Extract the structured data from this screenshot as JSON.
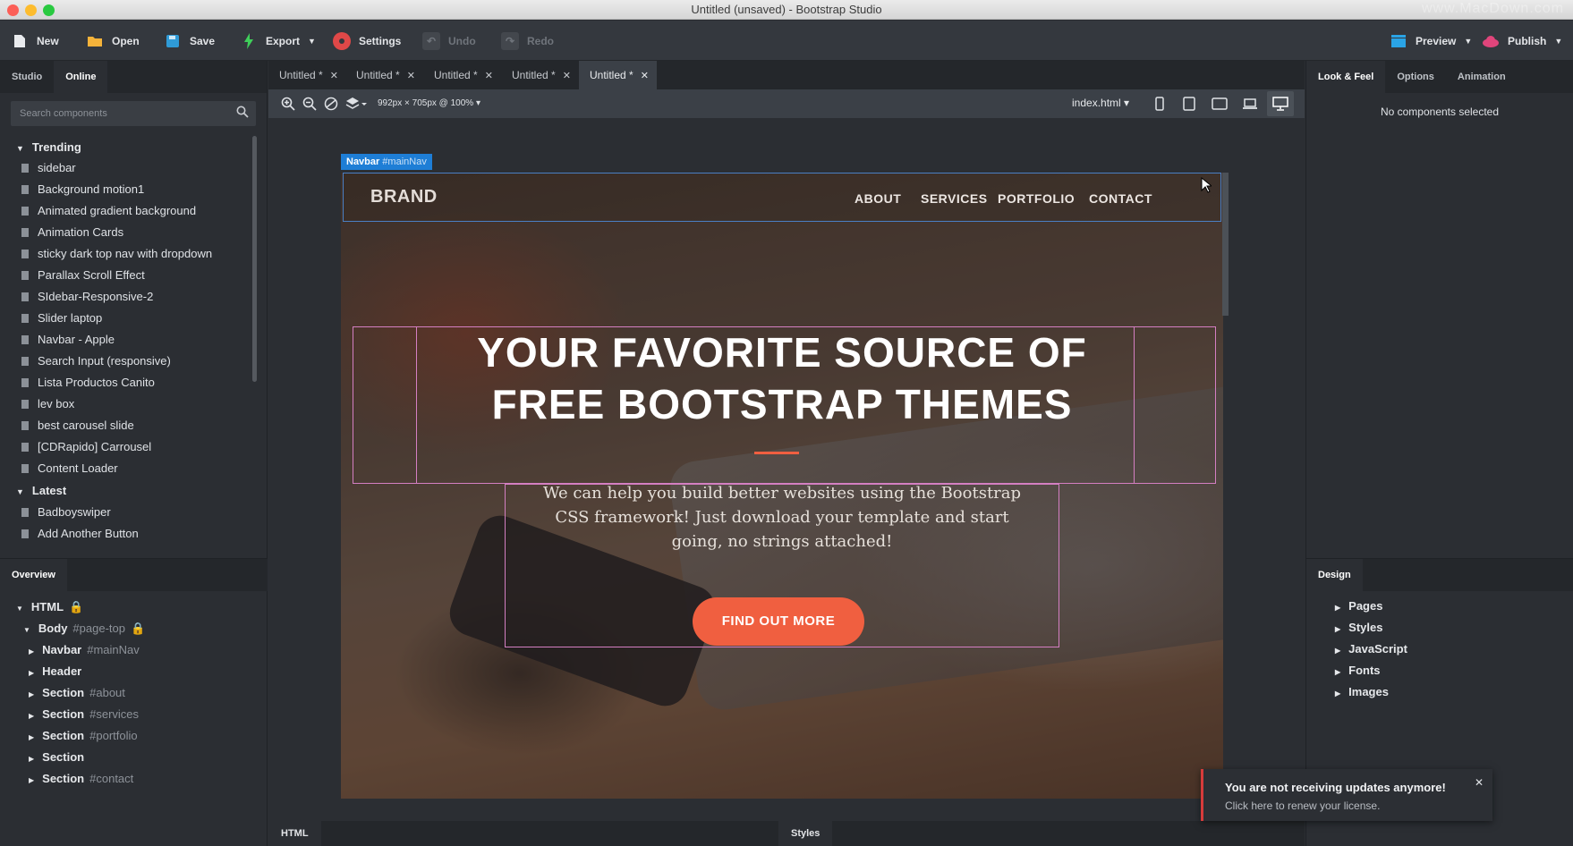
{
  "window": {
    "title": "Untitled (unsaved) - Bootstrap Studio",
    "watermark": "www.MacDown.com"
  },
  "toolbar": {
    "new": "New",
    "open": "Open",
    "save": "Save",
    "export": "Export",
    "settings": "Settings",
    "undo": "Undo",
    "redo": "Redo",
    "preview": "Preview",
    "publish": "Publish"
  },
  "left_panel": {
    "tabs": [
      "Studio",
      "Online"
    ],
    "search_placeholder": "Search components",
    "trending_label": "Trending",
    "trending": [
      "sidebar",
      "Background motion1",
      "Animated gradient background",
      "Animation Cards",
      "sticky dark top nav with dropdown",
      "Parallax Scroll Effect",
      "SIdebar-Responsive-2",
      "Slider laptop",
      "Navbar - Apple",
      "Search Input (responsive)",
      "Lista Productos Canito",
      "lev box",
      "best carousel slide",
      "[CDRapido] Carrousel",
      "Content Loader"
    ],
    "latest_label": "Latest",
    "latest": [
      "Badboyswiper",
      "Add Another Button"
    ]
  },
  "overview": {
    "title": "Overview",
    "html": "HTML",
    "body": "Body",
    "body_id": "#page-top",
    "nodes": [
      {
        "name": "Navbar",
        "id": "#mainNav"
      },
      {
        "name": "Header",
        "id": ""
      },
      {
        "name": "Section",
        "id": "#about"
      },
      {
        "name": "Section",
        "id": "#services"
      },
      {
        "name": "Section",
        "id": "#portfolio"
      },
      {
        "name": "Section",
        "id": ""
      },
      {
        "name": "Section",
        "id": "#contact"
      }
    ]
  },
  "doc_tabs": [
    "Untitled *",
    "Untitled *",
    "Untitled *",
    "Untitled *",
    "Untitled *"
  ],
  "canvas_bar": {
    "size": "992px × 705px @ 100%",
    "file": "index.html"
  },
  "page": {
    "navbar_label": "Navbar",
    "navbar_id": "#mainNav",
    "brand": "BRAND",
    "links": [
      "ABOUT",
      "SERVICES",
      "PORTFOLIO",
      "CONTACT"
    ],
    "heading_line1": "YOUR FAVORITE SOURCE OF",
    "heading_line2": "FREE BOOTSTRAP THEMES",
    "lead": "We can help you build better websites using the Bootstrap CSS framework! Just download your template and start going, no strings attached!",
    "cta": "FIND OUT MORE"
  },
  "right_panel": {
    "tabs": [
      "Look & Feel",
      "Options",
      "Animation"
    ],
    "empty": "No components selected",
    "design_title": "Design",
    "design_items": [
      "Pages",
      "Styles",
      "JavaScript",
      "Fonts",
      "Images"
    ]
  },
  "bottom_tabs": [
    "HTML",
    "Styles"
  ],
  "toast": {
    "title": "You are not receiving updates anymore!",
    "message": "Click here to renew your license."
  }
}
